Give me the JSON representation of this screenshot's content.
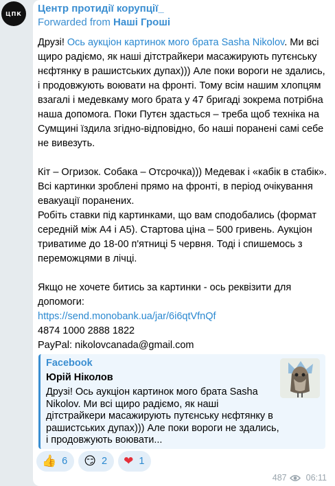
{
  "avatar_text": "ЦПК",
  "channel_name": "Центр протидії корупції_",
  "forwarded_prefix": "Forwarded from ",
  "forwarded_source": "Наші Гроші",
  "message": {
    "p1_start": "Друзі! ",
    "p1_link": "Ось аукціон картинок мого брата Sasha Nikolov",
    "p1_rest": ". Ми всі щиро радіємо, як наші дітстрайкери масажирують путєнську нєфтянку в рашистських дупах))) Але поки вороги не здались, і продовжують воювати на фронті. Тому всім нашим хлопцям взагалі і медевкаму мого брата у 47 бригаді зокрема потрібна наша допомога. Поки Путєн здасться – треба щоб техніка на Сумщині їздила згідно-відповідно, бо наші поранені самі себе не вивезуть.",
    "p2": "Кіт – Огризок. Собака – Отсрочка))) Медевак і «кабік в стабік». Всі картинки зроблені прямо на фронті, в період очікування евакуації поранених.",
    "p3": "Робіть ставки під картинками, що вам сподобались (формат середній між А4 і А5). Стартова ціна – 500 гривень. Аукціон триватиме до 18-00 п'ятниці 5 червня. Тоді і спишемось з переможцями в лічці.",
    "p4": "Якщо не хочете битись за картинки - ось реквізити для допомоги:",
    "bank_link": "https://send.monobank.ua/jar/6i6qtVfnQf",
    "card_number": "4874 1000 2888 1822",
    "paypal": "PayPal: nikolovcanada@gmail.com"
  },
  "preview": {
    "site": "Facebook",
    "title": "Юрій Ніколов",
    "description": "Друзі! Ось аукціон картинок мого брата Sasha Nikolov. Ми всі щиро радіємо, як наші дітстрайкери масажирують путєнську нєфтянку в рашистських дупах))) Але поки вороги не здались, і продовжують воювати..."
  },
  "reactions": [
    {
      "emoji": "👍",
      "count": "6"
    },
    {
      "emoji": "😏",
      "count": "2"
    },
    {
      "emoji": "❤",
      "count": "1"
    }
  ],
  "views": "487",
  "time": "06:11",
  "colors": {
    "accent": "#3a8ed1",
    "link": "#2a88d0",
    "heart": "#e5303a"
  }
}
